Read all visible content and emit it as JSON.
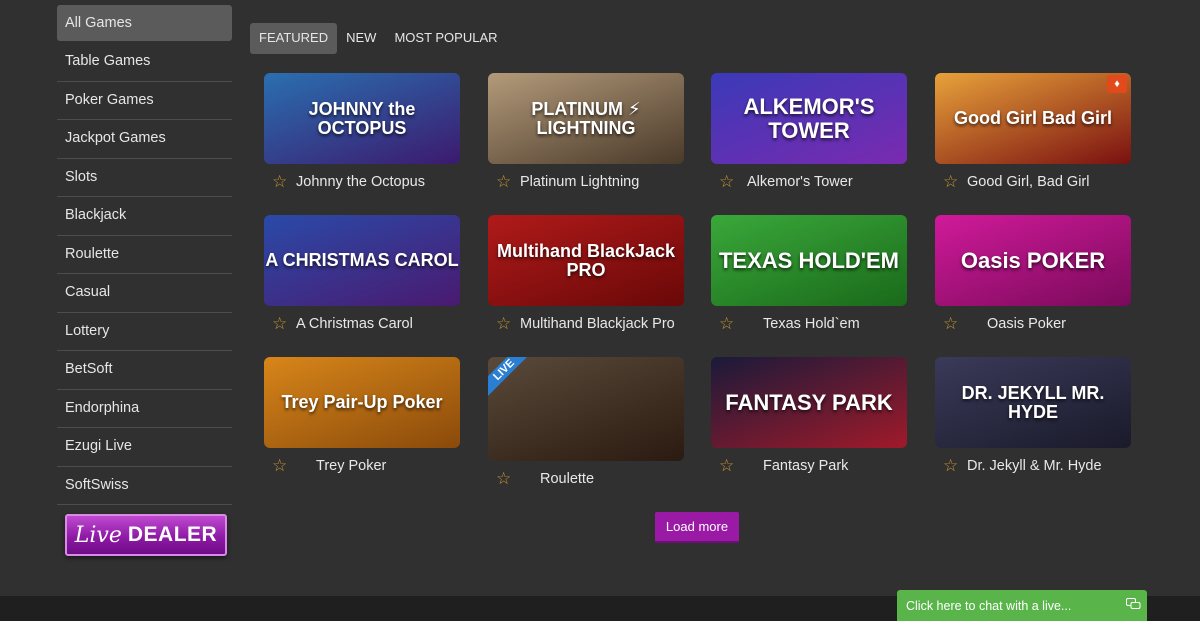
{
  "sidebar": {
    "items": [
      {
        "label": "All Games",
        "active": true
      },
      {
        "label": "Table Games"
      },
      {
        "label": "Poker Games"
      },
      {
        "label": "Jackpot Games"
      },
      {
        "label": "Slots"
      },
      {
        "label": "Blackjack"
      },
      {
        "label": "Roulette"
      },
      {
        "label": "Casual"
      },
      {
        "label": "Lottery"
      },
      {
        "label": "BetSoft"
      },
      {
        "label": "Endorphina"
      },
      {
        "label": "Ezugi Live"
      },
      {
        "label": "SoftSwiss"
      }
    ],
    "live_dealer": {
      "script": "Live",
      "word": "DEALER"
    }
  },
  "tabs": [
    {
      "label": "FEATURED",
      "active": true
    },
    {
      "label": "NEW"
    },
    {
      "label": "MOST POPULAR"
    }
  ],
  "games": [
    {
      "name": "Johnny the Octopus",
      "art": "JOHNNY the OCTOPUS",
      "bg": "#2a6fb0,#3c1a6e",
      "icon": "star-icon"
    },
    {
      "name": "Platinum Lightning",
      "art": "PLATINUM ⚡ LIGHTNING",
      "bg": "#b39a7a,#4a3a2a",
      "icon": "star-icon"
    },
    {
      "name": "Alkemor's Tower",
      "art": "ALKEMOR'S TOWER",
      "bg": "#3a3ab8,#7a2ab0",
      "icon": "star-icon"
    },
    {
      "name": "Good Girl, Bad Girl",
      "art": "Good Girl Bad Girl",
      "bg": "#e8a23a,#7a1010",
      "icon": "star-icon",
      "badge": "gem-icon"
    },
    {
      "name": "A Christmas Carol",
      "art": "A CHRISTMAS CAROL",
      "bg": "#2a4aa8,#4a1a70",
      "icon": "star-icon"
    },
    {
      "name": "Multihand Blackjack Pro",
      "art": "Multihand BlackJack PRO",
      "bg": "#b01a1a,#6a0808",
      "icon": "star-icon"
    },
    {
      "name": "Texas Hold`em",
      "art": "TEXAS HOLD'EM",
      "bg": "#3aa83a,#1a6a1a",
      "icon": "star-icon"
    },
    {
      "name": "Oasis Poker",
      "art": "Oasis POKER",
      "bg": "#d01a9a,#7a0a5a",
      "icon": "star-icon"
    },
    {
      "name": "Trey Poker",
      "art": "Trey Pair-Up Poker",
      "bg": "#d8861a,#8a4a0a",
      "icon": "star-icon"
    },
    {
      "name": "Roulette",
      "art": "",
      "bg": "#5a4a3a,#2a1a10",
      "icon": "star-icon",
      "live": "LIVE"
    },
    {
      "name": "Fantasy Park",
      "art": "FANTASY PARK",
      "bg": "#1a1a3a,#a01a2a",
      "icon": "star-icon"
    },
    {
      "name": "Dr. Jekyll & Mr. Hyde",
      "art": "DR. JEKYLL MR. HYDE",
      "bg": "#3a3a5a,#1a1a2a",
      "icon": "star-icon"
    }
  ],
  "load_more": "Load more",
  "chat": {
    "text": "Click here to chat with a live...",
    "icon": "chat-bubbles-icon"
  }
}
